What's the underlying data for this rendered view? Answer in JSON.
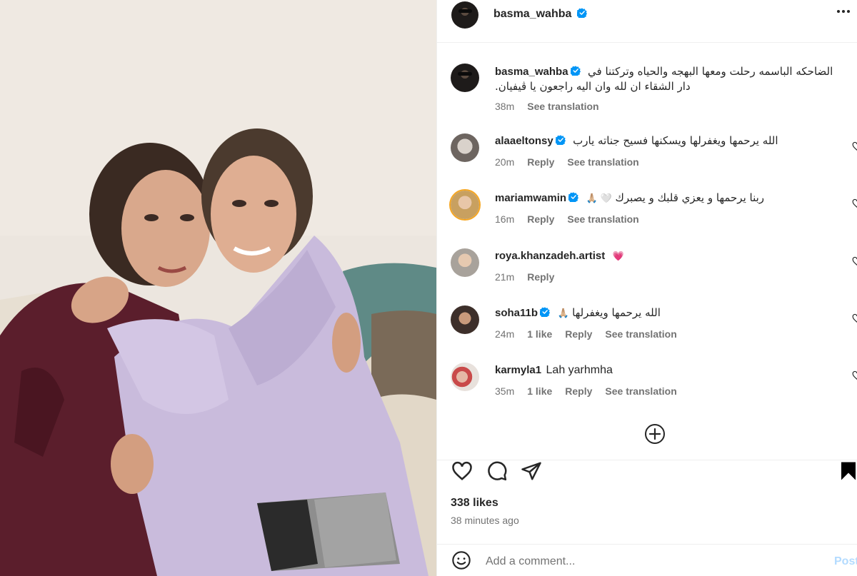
{
  "post": {
    "author": "basma_wahba",
    "caption": "الضاحكه الباسمه رحلت ومعها البهجه والحياه وتركتنا في دار الشقاء ان لله وان اليه راجعون يا ڤيفيان.",
    "caption_time": "38m",
    "caption_translate": "See translation",
    "likes": "338 likes",
    "posted": "38 minutes ago"
  },
  "comments": [
    {
      "user": "alaaeltonsy",
      "verified": true,
      "text": "الله يرحمها ويغفرلها ويسكنها فسيح جناته يارب",
      "time": "20m",
      "likes": "",
      "reply": "Reply",
      "translate": "See translation"
    },
    {
      "user": "mariamwamin",
      "verified": true,
      "text": "ربنا يرحمها و يعزي قلبك و يصبرك",
      "emoji": "🙏🏼 🤍",
      "time": "16m",
      "likes": "",
      "reply": "Reply",
      "translate": "See translation"
    },
    {
      "user": "roya.khanzadeh.artist",
      "verified": false,
      "text": "",
      "emoji": "💗",
      "time": "21m",
      "likes": "",
      "reply": "Reply",
      "translate": ""
    },
    {
      "user": "soha11b",
      "verified": true,
      "text": "الله يرحمها ويغفرلها",
      "emoji": "🙏🏼",
      "time": "24m",
      "likes": "1 like",
      "reply": "Reply",
      "translate": "See translation"
    },
    {
      "user": "karmyla1",
      "verified": false,
      "text": "Lah yarhmha",
      "time": "35m",
      "likes": "1 like",
      "reply": "Reply",
      "translate": "See translation"
    }
  ],
  "add_comment": {
    "placeholder": "Add a comment...",
    "post_label": "Post"
  },
  "icons": {
    "more": "more-horizontal-icon",
    "verified": "verified-badge-icon",
    "like": "heart-icon",
    "comment": "comment-icon",
    "share": "share-icon",
    "save": "bookmark-icon",
    "load_more": "plus-circle-icon",
    "emoji": "smiley-icon"
  },
  "colors": {
    "verified": "#0095f6",
    "post_disabled": "#b3dbff",
    "muted": "#737373",
    "text": "#262626",
    "save_filled": "#000000"
  }
}
